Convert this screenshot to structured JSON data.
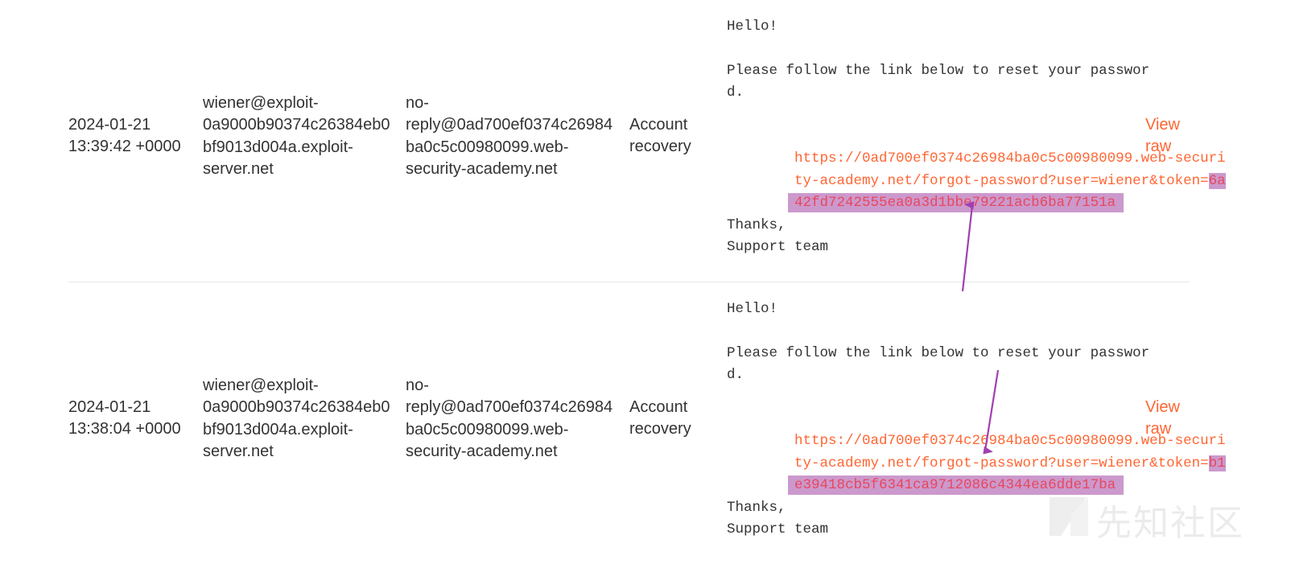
{
  "emails": [
    {
      "date": [
        "2024-01-21",
        "13:39:42 +0000"
      ],
      "to": [
        "wiener@exploit-",
        "0a9000b90374c26384eb0",
        "bf9013d004a.exploit-",
        "server.net"
      ],
      "from": [
        "no-",
        "reply@0ad700ef0374c26984",
        "ba0c5c00980099.web-",
        "security-academy.net"
      ],
      "subject": [
        "Account",
        "recovery"
      ],
      "body": {
        "greeting": "Hello!",
        "line1a": "Please follow the link below to reset your passwor",
        "line1b": "d.",
        "link1": "https://0ad700ef0374c26984ba0c5c00980099.web-securi",
        "link2_plain": "ty-academy.net/forgot-password?user=wiener&token=",
        "link2_token": "6a",
        "link3_token": "42fd7242555ea0a3d1bbe79221acb6ba77151a",
        "thanks": "Thanks,",
        "signature": "Support team"
      },
      "view_raw": [
        "View",
        "raw"
      ]
    },
    {
      "date": [
        "2024-01-21",
        "13:38:04 +0000"
      ],
      "to": [
        "wiener@exploit-",
        "0a9000b90374c26384eb0",
        "bf9013d004a.exploit-",
        "server.net"
      ],
      "from": [
        "no-",
        "reply@0ad700ef0374c26984",
        "ba0c5c00980099.web-",
        "security-academy.net"
      ],
      "subject": [
        "Account",
        "recovery"
      ],
      "body": {
        "greeting": "Hello!",
        "line1a": "Please follow the link below to reset your passwor",
        "line1b": "d.",
        "link1": "https://0ad700ef0374c26984ba0c5c00980099.web-securi",
        "link2_plain": "ty-academy.net/forgot-password?user=wiener&token=",
        "link2_token": "b1",
        "link3_token": "e39418cb5f6341ca9712086c4344ea6dde17ba",
        "thanks": "Thanks,",
        "signature": "Support team"
      },
      "view_raw": [
        "View",
        "raw"
      ]
    }
  ],
  "annotations": {
    "arrow_color": "#a040b0",
    "highlight_color": "#cc99cc"
  },
  "watermark": {
    "text": "先知社区"
  }
}
